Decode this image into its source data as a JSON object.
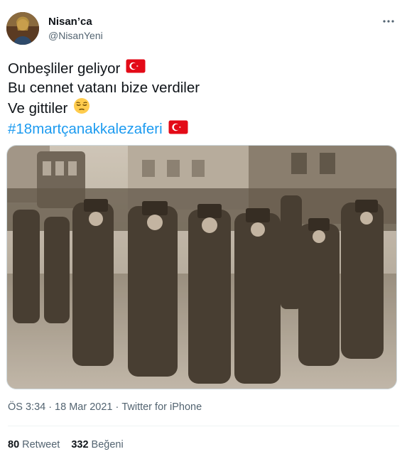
{
  "author": {
    "name": "Nisan’ca",
    "handle": "@NisanYeni"
  },
  "tweet": {
    "lines": [
      {
        "text": "Onbeşliler geliyor",
        "emoji": "turkish-flag"
      },
      {
        "text": "Bu cennet vatanı bize verdiler",
        "emoji": ""
      },
      {
        "text": "Ve gittiler",
        "emoji": "pensive-face"
      }
    ],
    "hashtag": "#18martçanakkalezaferi",
    "hashtag_emoji": "turkish-flag"
  },
  "media": {
    "icon": "sepia-photo",
    "tone": "#9a8f80"
  },
  "meta": {
    "time": "ÖS 3:34",
    "separator1": "·",
    "date": "18 Mar 2021",
    "separator2": "·",
    "source": "Twitter for iPhone"
  },
  "stats": {
    "retweets_count": "80",
    "retweets_label": "Retweet",
    "likes_count": "332",
    "likes_label": "Beğeni"
  },
  "colors": {
    "text": "#0f1419",
    "secondary": "#536471",
    "link": "#1d9bf0",
    "flag_red": "#e30a17"
  }
}
